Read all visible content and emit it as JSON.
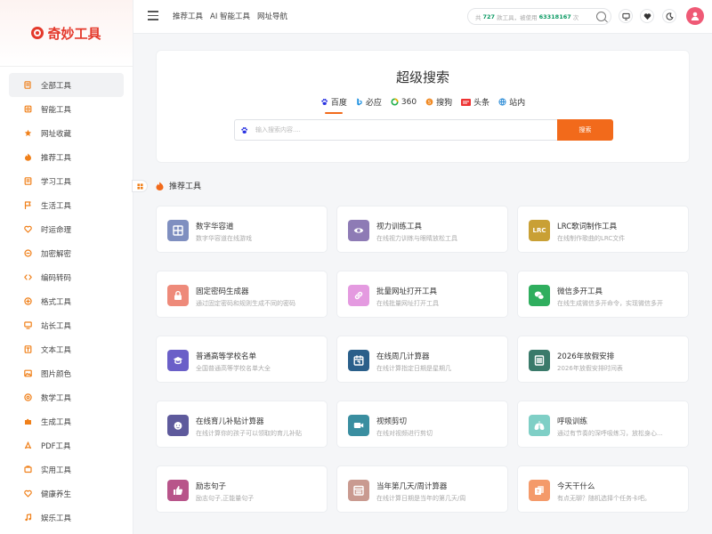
{
  "brand": {
    "name": "奇妙工具",
    "logo_color": "#e4392b"
  },
  "sidebar": {
    "items": [
      {
        "label": "全部工具",
        "icon": "docs-icon",
        "active": true
      },
      {
        "label": "智能工具",
        "icon": "chip-icon"
      },
      {
        "label": "网址收藏",
        "icon": "star-icon"
      },
      {
        "label": "推荐工具",
        "icon": "flame-icon"
      },
      {
        "label": "学习工具",
        "icon": "book-icon"
      },
      {
        "label": "生活工具",
        "icon": "flag-icon"
      },
      {
        "label": "时运命理",
        "icon": "heart-icon"
      },
      {
        "label": "加密解密",
        "icon": "lock-icon"
      },
      {
        "label": "编码转码",
        "icon": "code-icon"
      },
      {
        "label": "格式工具",
        "icon": "format-icon"
      },
      {
        "label": "站长工具",
        "icon": "monitor-icon"
      },
      {
        "label": "文本工具",
        "icon": "text-icon"
      },
      {
        "label": "图片颜色",
        "icon": "image-icon"
      },
      {
        "label": "数学工具",
        "icon": "at-icon"
      },
      {
        "label": "生成工具",
        "icon": "puzzle-icon"
      },
      {
        "label": "PDF工具",
        "icon": "pdf-icon"
      },
      {
        "label": "实用工具",
        "icon": "box-icon"
      },
      {
        "label": "健康养生",
        "icon": "health-icon"
      },
      {
        "label": "娱乐工具",
        "icon": "music-icon"
      }
    ]
  },
  "header": {
    "nav": [
      "推荐工具",
      "AI 智能工具",
      "网址导航"
    ],
    "stats": {
      "prefix": "共",
      "tool_count": "727",
      "mid": "款工具，被使用",
      "use_count": "63318167",
      "suffix": "次"
    }
  },
  "search": {
    "title": "超级搜索",
    "engines": [
      {
        "label": "百度",
        "icon": "baidu-icon",
        "color": "#2932e1",
        "active": true
      },
      {
        "label": "必应",
        "icon": "bing-icon",
        "color": "#1a8fe0"
      },
      {
        "label": "360",
        "icon": "so360-icon",
        "color": "#1fae4a"
      },
      {
        "label": "搜狗",
        "icon": "sogou-icon",
        "color": "#f08a24"
      },
      {
        "label": "头条",
        "icon": "toutiao-icon",
        "color": "#e33"
      },
      {
        "label": "站内",
        "icon": "globe-icon",
        "color": "#2b8bd6"
      }
    ],
    "placeholder": "输入搜索内容....",
    "button": "搜索",
    "accent": "#f26a1b"
  },
  "section": {
    "title": "推荐工具"
  },
  "cards": [
    {
      "title": "数字华容道",
      "desc": "数字华容道在线游戏",
      "icon": "grid-icon",
      "color": "#7f8fc0"
    },
    {
      "title": "视力训练工具",
      "desc": "在线视力训练与眼睛放松工具",
      "icon": "eye-icon",
      "color": "#8e7bb5"
    },
    {
      "title": "LRC歌词制作工具",
      "desc": "在线制作歌曲的LRC文件",
      "icon": "lrc-icon",
      "icon_text": "LRC",
      "color": "#c9a035"
    },
    {
      "title": "固定密码生成器",
      "desc": "通过固定密码和规则生成不同的密码",
      "icon": "lock-icon",
      "color": "#ee8a7a"
    },
    {
      "title": "批量网址打开工具",
      "desc": "在线批量网址打开工具",
      "icon": "link-icon",
      "color": "#e49ae0"
    },
    {
      "title": "微信多开工具",
      "desc": "在线生成微信多开命令，实现微信多开",
      "icon": "wechat-icon",
      "color": "#2fae5e"
    },
    {
      "title": "普通高等学校名单",
      "desc": "全国普通高等学校名单大全",
      "icon": "graduation-icon",
      "color": "#6a5fc8"
    },
    {
      "title": "在线周几计算器",
      "desc": "在线计算指定日期是星期几",
      "icon": "calendar-icon",
      "color": "#2a5f8a"
    },
    {
      "title": "2026年放假安排",
      "desc": "2026年放假安排时间表",
      "icon": "schedule-icon",
      "color": "#3a7a6a"
    },
    {
      "title": "在线育儿补贴计算器",
      "desc": "在线计算你的孩子可以领取的育儿补贴",
      "icon": "baby-icon",
      "color": "#5e5a9c"
    },
    {
      "title": "视频剪切",
      "desc": "在线对视频进行剪切",
      "icon": "video-icon",
      "color": "#3a8ea0"
    },
    {
      "title": "呼吸训练",
      "desc": "通过有节奏的深呼吸练习，放松身心...",
      "icon": "lungs-icon",
      "color": "#7fcfc6"
    },
    {
      "title": "励志句子",
      "desc": "励志句子,正能量句子",
      "icon": "thumbs-up-icon",
      "color": "#b8548a"
    },
    {
      "title": "当年第几天/周计算器",
      "desc": "在线计算日期是当年的第几天/周",
      "icon": "calendar-grid-icon",
      "color": "#c99a90"
    },
    {
      "title": "今天干什么",
      "desc": "有点无聊？随机选择个任务卡吧。",
      "icon": "cards-icon",
      "color": "#f49a6a"
    }
  ]
}
